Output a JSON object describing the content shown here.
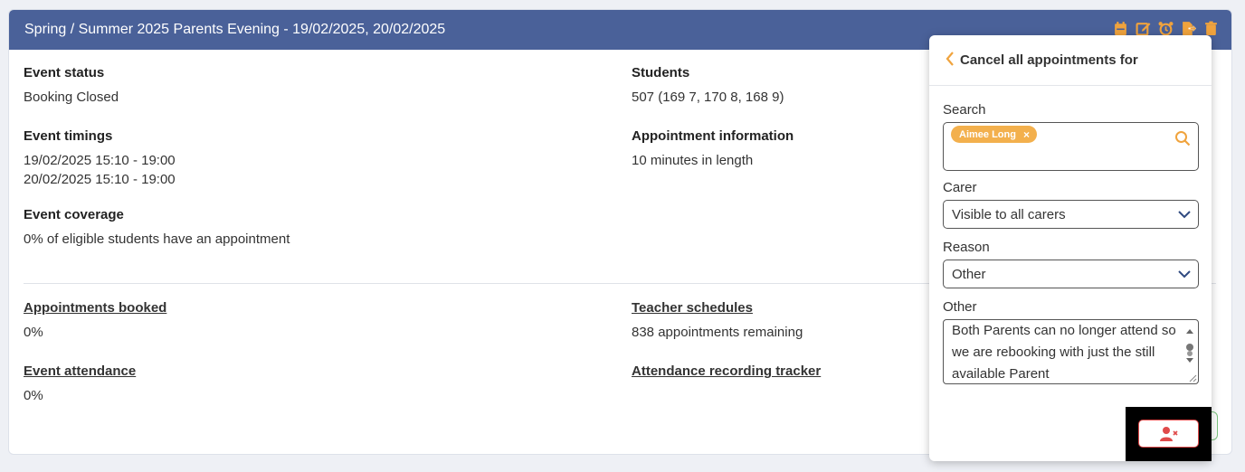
{
  "event": {
    "title": "Spring / Summer 2025 Parents Evening - 19/02/2025, 20/02/2025",
    "header_icons": [
      "calendar-icon",
      "edit-icon",
      "alarm-clock-icon",
      "export-file-icon",
      "trash-icon"
    ],
    "status": {
      "label": "Event status",
      "value": "Booking Closed"
    },
    "students": {
      "label": "Students",
      "value": "507 (169 7, 170 8, 168 9)"
    },
    "timings": {
      "label": "Event timings",
      "line1": "19/02/2025 15:10 - 19:00",
      "line2": "20/02/2025 15:10 - 19:00"
    },
    "appointment_info": {
      "label": "Appointment information",
      "value": "10 minutes in length"
    },
    "coverage": {
      "label": "Event coverage",
      "value": "0% of eligible students have an appointment"
    },
    "appointments_booked": {
      "label": "Appointments booked",
      "value": "0%"
    },
    "teacher_schedules": {
      "label": "Teacher schedules",
      "value": "838 appointments remaining"
    },
    "attendance": {
      "label": "Event attendance",
      "value": "0%"
    },
    "attendance_tracker": {
      "label": "Attendance recording tracker"
    }
  },
  "panel": {
    "title": "Cancel all appointments for",
    "search": {
      "label": "Search",
      "chip": "Aimee Long",
      "chip_close": "×"
    },
    "carer": {
      "label": "Carer",
      "value": "Visible to all carers"
    },
    "reason": {
      "label": "Reason",
      "value": "Other"
    },
    "other": {
      "label": "Other",
      "value": "Both Parents can no longer attend so we are rebooking with just the still available Parent"
    }
  },
  "colors": {
    "header_bg": "#4a6199",
    "accent": "#f0a33d",
    "danger": "#e04a4a"
  }
}
